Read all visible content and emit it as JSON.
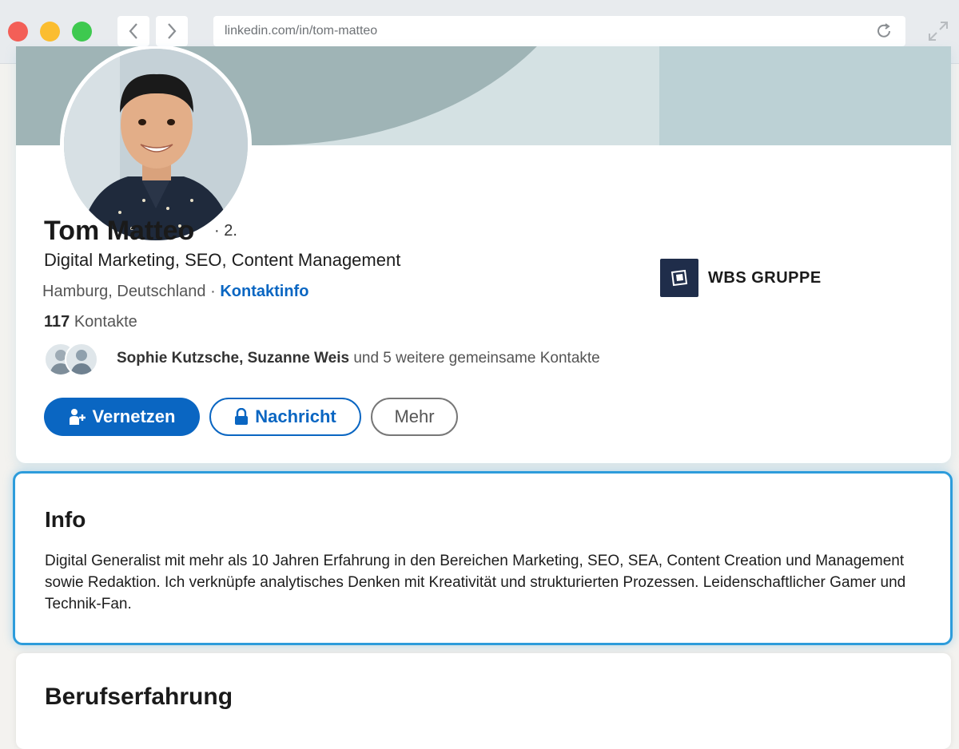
{
  "browser": {
    "url": "linkedin.com/in/tom-matteo"
  },
  "profile": {
    "name": "Tom Matteo",
    "degree": "· 2.",
    "headline": "Digital Marketing, SEO, Content Management",
    "location": "Hamburg, Deutschland",
    "location_sep": " · ",
    "contact_info_link": "Kontaktinfo",
    "contacts_count": "117",
    "contacts_label": " Kontakte",
    "mutual_names": "Sophie Kutzsche, Suzanne Weis",
    "mutual_rest": " und 5 weitere gemeinsame Kontakte",
    "company": "WBS GRUPPE"
  },
  "actions": {
    "connect": "Vernetzen",
    "message": "Nachricht",
    "more": "Mehr"
  },
  "info": {
    "title": "Info",
    "text": "Digital Generalist mit mehr als 10 Jahren Erfahrung in den Bereichen Marketing, SEO, SEA, Content Creation und Management sowie Redaktion. Ich verknüpfe analytisches Denken mit Kreativität und strukturierten Prozessen. Leidenschaftlicher Gamer und Technik-Fan."
  },
  "experience": {
    "title": "Berufserfahrung"
  },
  "colors": {
    "linkedin_blue": "#0a66c2",
    "highlight_border": "#2d9cdb"
  }
}
